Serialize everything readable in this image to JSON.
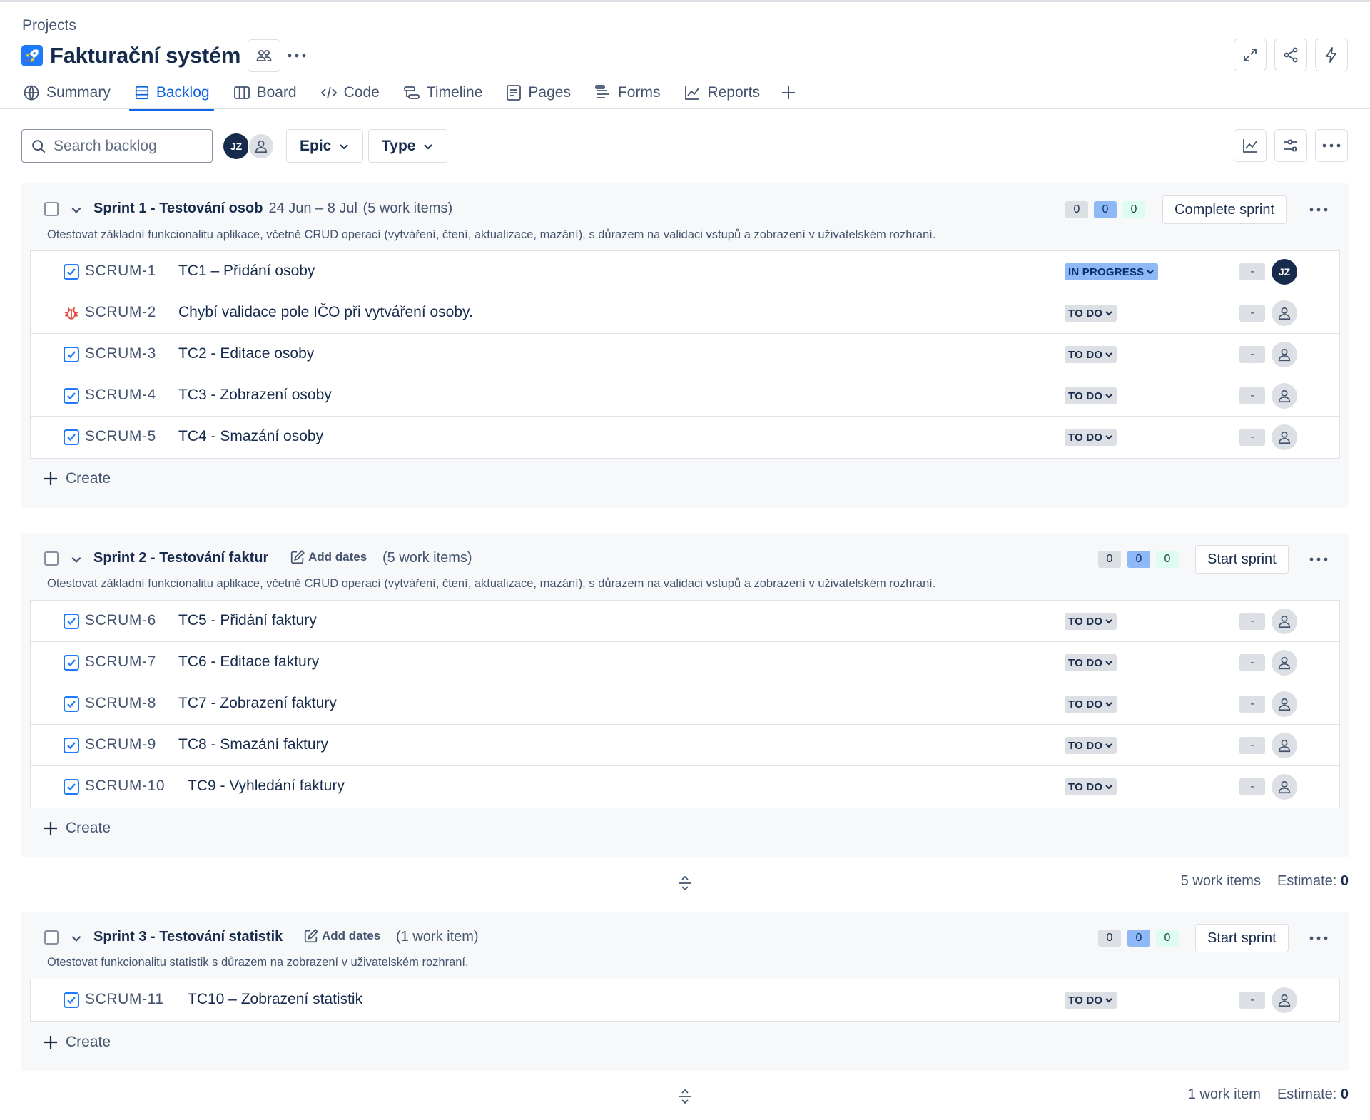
{
  "breadcrumb": "Projects",
  "project": {
    "title": "Fakturační systém",
    "icon": "rocket-icon"
  },
  "tabs": [
    {
      "label": "Summary",
      "icon": "globe-icon"
    },
    {
      "label": "Backlog",
      "icon": "backlog-icon",
      "active": true
    },
    {
      "label": "Board",
      "icon": "board-icon"
    },
    {
      "label": "Code",
      "icon": "code-icon"
    },
    {
      "label": "Timeline",
      "icon": "timeline-icon"
    },
    {
      "label": "Pages",
      "icon": "pages-icon"
    },
    {
      "label": "Forms",
      "icon": "forms-icon"
    },
    {
      "label": "Reports",
      "icon": "reports-icon"
    }
  ],
  "toolbar": {
    "search_placeholder": "Search backlog",
    "avatar_initials": "JZ",
    "filters": [
      "Epic",
      "Type"
    ]
  },
  "colors": {
    "accent": "#0c66e4",
    "in_progress": "#8fb8f6",
    "todo": "#dcdfe4",
    "done": "#dffcf0",
    "bug": "#e2483d"
  },
  "sprints": [
    {
      "name": "Sprint 1 - Testování osob",
      "dates": "24 Jun – 8 Jul",
      "count": "(5 work items)",
      "description": "Otestovat základní funkcionalitu aplikace, včetně CRUD operací (vytváření, čtení, aktualizace, mazání), s důrazem na validaci vstupů a zobrazení v uživatelském rozhraní.",
      "pills": {
        "todo": "0",
        "in_progress": "0",
        "done": "0"
      },
      "button": "Complete sprint",
      "items": [
        {
          "key": "SCRUM-1",
          "title": "TC1 – Přidání osoby",
          "type": "task",
          "status": "IN PROGRESS",
          "estimate": "-",
          "assignee": "JZ"
        },
        {
          "key": "SCRUM-2",
          "title": "Chybí validace pole IČO při vytváření osoby.",
          "type": "bug",
          "status": "TO DO",
          "estimate": "-",
          "assignee": ""
        },
        {
          "key": "SCRUM-3",
          "title": "TC2 - Editace osoby",
          "type": "task",
          "status": "TO DO",
          "estimate": "-",
          "assignee": ""
        },
        {
          "key": "SCRUM-4",
          "title": "TC3 - Zobrazení osoby",
          "type": "task",
          "status": "TO DO",
          "estimate": "-",
          "assignee": ""
        },
        {
          "key": "SCRUM-5",
          "title": "TC4 - Smazání osoby",
          "type": "task",
          "status": "TO DO",
          "estimate": "-",
          "assignee": ""
        }
      ],
      "create_label": "Create"
    },
    {
      "name": "Sprint 2 - Testování faktur",
      "add_dates": "Add dates",
      "count": "(5 work items)",
      "description": "Otestovat základní funkcionalitu aplikace, včetně CRUD operací (vytváření, čtení, aktualizace, mazání), s důrazem na validaci vstupů a zobrazení v uživatelském rozhraní.",
      "pills": {
        "todo": "0",
        "in_progress": "0",
        "done": "0"
      },
      "button": "Start sprint",
      "items": [
        {
          "key": "SCRUM-6",
          "title": "TC5 - Přidání faktury",
          "type": "task",
          "status": "TO DO",
          "estimate": "-",
          "assignee": ""
        },
        {
          "key": "SCRUM-7",
          "title": "TC6 - Editace faktury",
          "type": "task",
          "status": "TO DO",
          "estimate": "-",
          "assignee": ""
        },
        {
          "key": "SCRUM-8",
          "title": "TC7 - Zobrazení faktury",
          "type": "task",
          "status": "TO DO",
          "estimate": "-",
          "assignee": ""
        },
        {
          "key": "SCRUM-9",
          "title": "TC8 - Smazání faktury",
          "type": "task",
          "status": "TO DO",
          "estimate": "-",
          "assignee": ""
        },
        {
          "key": "SCRUM-10",
          "title": "TC9 - Vyhledání faktury",
          "type": "task",
          "status": "TO DO",
          "estimate": "-",
          "assignee": ""
        }
      ],
      "create_label": "Create",
      "summary": {
        "items": "5 work items",
        "estimate_label": "Estimate:",
        "estimate_value": "0"
      }
    },
    {
      "name": "Sprint 3 - Testování statistik",
      "add_dates": "Add dates",
      "count": "(1 work item)",
      "description": "Otestovat funkcionalitu statistik s důrazem na zobrazení v uživatelském rozhraní.",
      "pills": {
        "todo": "0",
        "in_progress": "0",
        "done": "0"
      },
      "button": "Start sprint",
      "items": [
        {
          "key": "SCRUM-11",
          "title": "TC10 – Zobrazení statistik",
          "type": "task",
          "status": "TO DO",
          "estimate": "-",
          "assignee": ""
        }
      ],
      "create_label": "Create",
      "summary": {
        "items": "1 work item",
        "estimate_label": "Estimate:",
        "estimate_value": "0"
      }
    }
  ]
}
